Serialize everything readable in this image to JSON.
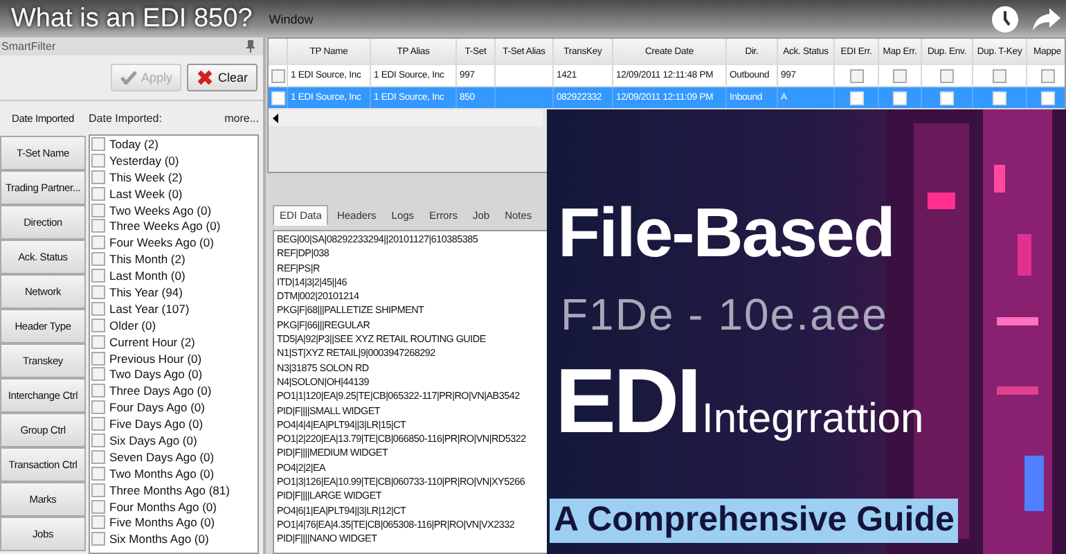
{
  "video": {
    "title": "What is an EDI 850?"
  },
  "menu": [
    "Window"
  ],
  "smart_filter": {
    "title": "SmartFilter",
    "buttons": [
      {
        "label": "Apply",
        "kind": "apply",
        "disabled": true
      },
      {
        "label": "Clear",
        "kind": "clear",
        "disabled": false
      }
    ],
    "field_title": "Date Imported:",
    "more": "more...",
    "filters": [
      {
        "label": "Date Imported",
        "selected": true
      },
      {
        "label": "T-Set Name",
        "selected": false
      },
      {
        "label": "Trading Partner...",
        "selected": false
      },
      {
        "label": "Direction",
        "selected": false
      },
      {
        "label": "Ack. Status",
        "selected": false
      },
      {
        "label": "Network",
        "selected": false
      },
      {
        "label": "Header Type",
        "selected": false
      },
      {
        "label": "Transkey",
        "selected": false
      },
      {
        "label": "Interchange Ctrl",
        "selected": false
      },
      {
        "label": "Group Ctrl",
        "selected": false
      },
      {
        "label": "Transaction Ctrl",
        "selected": false
      },
      {
        "label": "Marks",
        "selected": false
      },
      {
        "label": "Jobs",
        "selected": false
      }
    ],
    "options": [
      {
        "label": "Today (2)",
        "checked": false
      },
      {
        "label": "Yesterday (0)",
        "checked": false
      },
      {
        "label": "This Week (2)",
        "checked": false
      },
      {
        "label": "Last Week (0)",
        "checked": false
      },
      {
        "label": "Two Weeks Ago (0)",
        "checked": false
      },
      {
        "label": "Three Weeks Ago (0)",
        "checked": false
      },
      {
        "label": "Four Weeks Ago (0)",
        "checked": false
      },
      {
        "label": "This Month (2)",
        "checked": false
      },
      {
        "label": "Last Month (0)",
        "checked": false
      },
      {
        "label": "This Year (94)",
        "checked": false
      },
      {
        "label": "Last Year (107)",
        "checked": false
      },
      {
        "label": "Older (0)",
        "checked": false
      },
      {
        "label": "Current Hour (2)",
        "checked": false
      },
      {
        "label": "Previous Hour (0)",
        "checked": false
      },
      {
        "label": "Two Days Ago (0)",
        "checked": false
      },
      {
        "label": "Three Days Ago (0)",
        "checked": false
      },
      {
        "label": "Four Days Ago (0)",
        "checked": false
      },
      {
        "label": "Five Days Ago (0)",
        "checked": false
      },
      {
        "label": "Six Days Ago (0)",
        "checked": false
      },
      {
        "label": "Seven Days Ago (0)",
        "checked": false
      },
      {
        "label": "Two Months Ago (0)",
        "checked": false
      },
      {
        "label": "Three Months Ago (81)",
        "checked": false
      },
      {
        "label": "Four Months Ago (0)",
        "checked": false
      },
      {
        "label": "Five Months Ago (0)",
        "checked": false
      },
      {
        "label": "Six Months Ago (0)",
        "checked": false
      }
    ]
  },
  "grid": {
    "columns": [
      "TP Name",
      "TP Alias",
      "T-Set",
      "T-Set Alias",
      "TransKey",
      "Create Date",
      "Dir.",
      "Ack. Status",
      "EDI Err.",
      "Map Err.",
      "Dup. Env.",
      "Dup. T-Key",
      "Mappe"
    ],
    "rows": [
      {
        "selected": false,
        "checked": false,
        "cells": [
          "1 EDI Source, Inc",
          "1 EDI Source, Inc",
          "997",
          null,
          "1421",
          "12/09/2011 12:11:48 PM",
          "Outbound",
          "997"
        ],
        "flags": [
          false,
          false,
          false,
          false,
          false
        ]
      },
      {
        "selected": true,
        "checked": false,
        "cells": [
          "1 EDI Source, Inc",
          "1 EDI Source, Inc",
          "850",
          null,
          "082922332",
          "12/09/2011 12:11:09 PM",
          "Inbound",
          "A"
        ],
        "flags": [
          false,
          false,
          false,
          false,
          false
        ]
      }
    ]
  },
  "detail": {
    "tabs": [
      {
        "label": "EDI Data",
        "selected": true
      },
      {
        "label": "Headers",
        "selected": false
      },
      {
        "label": "Logs",
        "selected": false
      },
      {
        "label": "Errors",
        "selected": false
      },
      {
        "label": "Job",
        "selected": false
      },
      {
        "label": "Notes",
        "selected": false
      }
    ],
    "lines": [
      "BEG|00|SA|08292233294||20101127|610385385",
      "REF|DP|038",
      "REF|PS|R",
      "ITD|14|3|2|45||46",
      "DTM|002|20101214",
      "PKG|F|68|||PALLETIZE SHIPMENT",
      "PKG|F|66|||REGULAR",
      "TD5|A|92|P3||SEE XYZ RETAIL ROUTING GUIDE",
      "N1|ST|XYZ RETAIL|9|0003947268292",
      "N3|31875 SOLON RD",
      "N4|SOLON|OH|44139",
      "PO1|1|120|EA|9.25|TE|CB|065322-117|PR|RO|VN|AB3542",
      "PID|F||||SMALL WIDGET",
      "PO4|4|4|EA|PLT94||3|LR|15|CT",
      "PO1|2|220|EA|13.79|TE|CB|066850-116|PR|RO|VN|RD5322",
      "PID|F||||MEDIUM WIDGET",
      "PO4|2|2|EA",
      "PO1|3|126|EA|10.99|TE|CB|060733-110|PR|RO|VN|XY5266",
      "PID|F||||LARGE WIDGET",
      "PO4|6|1|EA|PLT94||3|LR|12|CT",
      "PO1|4|76|EA|4.35|TE|CB|065308-116|PR|RO|VN|VX2332",
      "PID|F||||NANO WIDGET"
    ]
  },
  "overlay": {
    "title": "File-Based",
    "subtitle": "F1De - 10e.aee",
    "heading": "EDI",
    "heading_suffix": "Integrrattion",
    "banner": "A Comprehensive Guide"
  }
}
